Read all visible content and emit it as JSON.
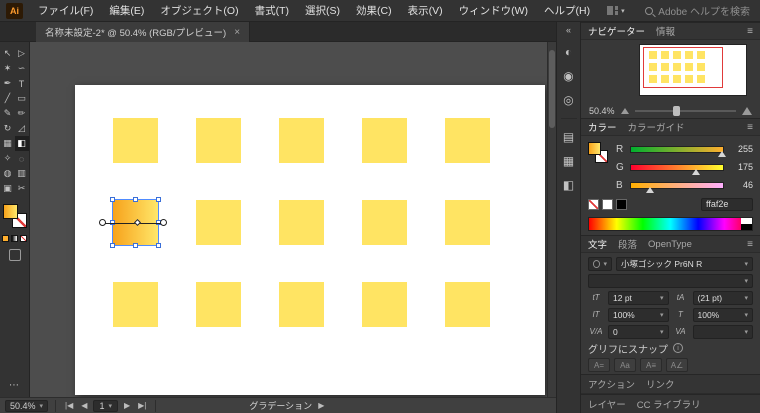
{
  "colors": {
    "sq": "#ffe463",
    "gfrom": "#f7a21b",
    "gto": "#ffe76a",
    "red": "#e03a3a",
    "sel": "#4f8bff"
  },
  "menubar": {
    "logo": "Ai",
    "items": [
      "ファイル(F)",
      "編集(E)",
      "オブジェクト(O)",
      "書式(T)",
      "選択(S)",
      "効果(C)",
      "表示(V)",
      "ウィンドウ(W)",
      "ヘルプ(H)"
    ],
    "search_placeholder": "Adobe ヘルプを検索"
  },
  "document_tab": {
    "title": "名称未設定-2* @ 50.4% (RGB/プレビュー)",
    "close_label": "×"
  },
  "toolbar": {
    "tools": [
      {
        "name": "selection-tool",
        "glyph": "↖"
      },
      {
        "name": "direct-selection-tool",
        "glyph": "▷"
      },
      {
        "name": "magic-wand-tool",
        "glyph": "✶"
      },
      {
        "name": "lasso-tool",
        "glyph": "∽"
      },
      {
        "name": "pen-tool",
        "glyph": "✒"
      },
      {
        "name": "type-tool",
        "glyph": "T"
      },
      {
        "name": "line-segment-tool",
        "glyph": "╱"
      },
      {
        "name": "rectangle-tool",
        "glyph": "▭"
      },
      {
        "name": "paintbrush-tool",
        "glyph": "✎"
      },
      {
        "name": "pencil-tool",
        "glyph": "✏"
      },
      {
        "name": "rotate-tool",
        "glyph": "↻"
      },
      {
        "name": "scale-tool",
        "glyph": "◿"
      },
      {
        "name": "mesh-tool",
        "glyph": "▦"
      },
      {
        "name": "gradient-tool",
        "glyph": "◧"
      },
      {
        "name": "eyedropper-tool",
        "glyph": "✧"
      },
      {
        "name": "blend-tool",
        "glyph": "◌"
      },
      {
        "name": "symbol-sprayer-tool",
        "glyph": "◍"
      },
      {
        "name": "column-graph-tool",
        "glyph": "▥"
      },
      {
        "name": "artboard-tool",
        "glyph": "▣"
      },
      {
        "name": "slice-tool",
        "glyph": "✂"
      }
    ],
    "more_glyph": "⋯"
  },
  "dock": {
    "collapse_glyph": "«",
    "icons": [
      {
        "name": "dock-icon-properties",
        "glyph": "◐"
      },
      {
        "name": "dock-icon-libraries",
        "glyph": "◉"
      },
      {
        "name": "dock-icon-appearance",
        "glyph": "◎"
      },
      {
        "name": "dock-icon-swatches",
        "glyph": "▤"
      },
      {
        "name": "dock-icon-brushes",
        "glyph": "▦"
      },
      {
        "name": "dock-icon-symbols",
        "glyph": "◧"
      }
    ]
  },
  "navigator": {
    "tabs": [
      "ナビゲーター",
      "情報"
    ],
    "zoom": "50.4%"
  },
  "color_panel": {
    "tabs": [
      "カラー",
      "カラーガイド"
    ],
    "channels": [
      {
        "label": "R",
        "value": "255"
      },
      {
        "label": "G",
        "value": "175"
      },
      {
        "label": "B",
        "value": "46"
      }
    ],
    "hex": "ffaf2e"
  },
  "character_panel": {
    "tabs": [
      "文字",
      "段落",
      "OpenType"
    ],
    "font_name": "小塚ゴシック Pr6N R",
    "font_style": "",
    "font_size": "12 pt",
    "leading": "(21 pt)",
    "vertical_scale": "100%",
    "horizontal_scale": "100%",
    "kerning": "0",
    "tracking": "",
    "glyph_snap_label": "グリフにスナップ",
    "snap_buttons": [
      "A=",
      "Aa",
      "A≡",
      "A∠"
    ]
  },
  "icons": {
    "font_size": "tT",
    "leading": "tA",
    "vertical_scale": "IT",
    "horizontal_scale": "T",
    "kerning": "V/A",
    "tracking": "VA"
  },
  "action_panel": {
    "tabs": [
      "アクション",
      "リンク"
    ]
  },
  "layers_panel": {
    "tabs": [
      "レイヤー",
      "CC ライブラリ"
    ]
  },
  "statusbar": {
    "zoom": "50.4%",
    "artboard": "1",
    "tool_label": "グラデーション"
  }
}
